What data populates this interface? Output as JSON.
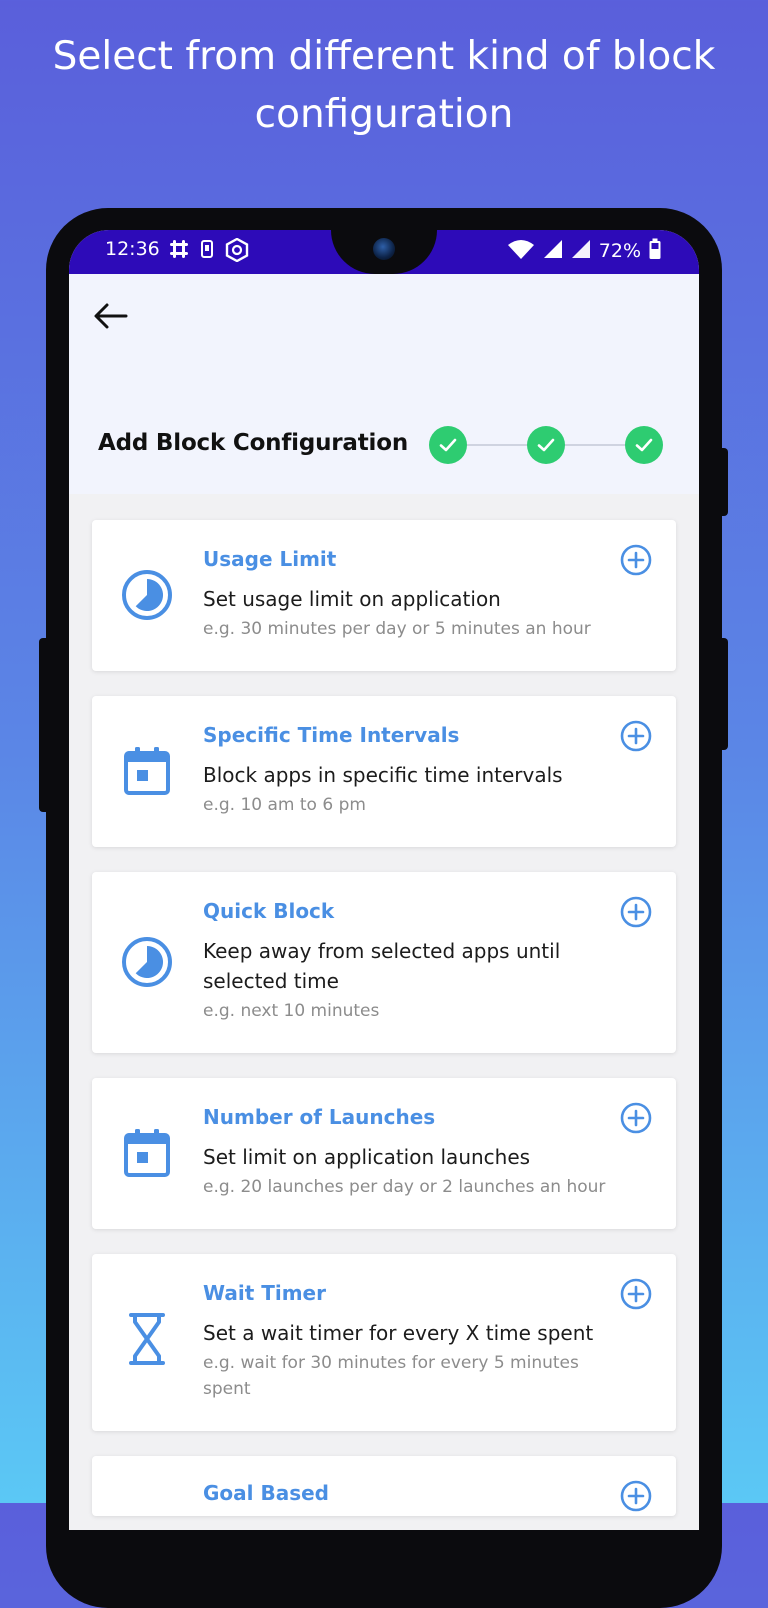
{
  "headline": {
    "line1": "Select from different kind of block",
    "line2": "configuration"
  },
  "status_bar": {
    "time": "12:36",
    "battery": "72%",
    "left_icons": [
      "slack-icon",
      "phone-outline-icon",
      "hexagon-app-icon"
    ],
    "right_icons": [
      "wifi-icon",
      "signal-icon",
      "signal-icon",
      "battery-icon"
    ]
  },
  "header": {
    "back_icon": "back-arrow-icon",
    "title": "Add Block Configuration",
    "steps_completed": 3,
    "steps_total": 3
  },
  "colors": {
    "status_bar": "#2d0bb8",
    "accent": "#4a8fe3",
    "step_done": "#2ecc71"
  },
  "cards": [
    {
      "icon": "clock-pie-icon",
      "title": "Usage Limit",
      "description": "Set usage limit on application",
      "example": "e.g. 30 minutes per day or 5 minutes an hour"
    },
    {
      "icon": "calendar-icon",
      "title": "Specific Time Intervals",
      "description": "Block apps in specific time intervals",
      "example": "e.g. 10 am to 6 pm"
    },
    {
      "icon": "clock-pie-icon",
      "title": "Quick Block",
      "description": "Keep away from selected apps until selected time",
      "example": "e.g. next 10 minutes"
    },
    {
      "icon": "calendar-icon",
      "title": "Number of Launches",
      "description": "Set limit on application launches",
      "example": "e.g. 20 launches per day or 2 launches an hour"
    },
    {
      "icon": "hourglass-icon",
      "title": "Wait Timer",
      "description": "Set a wait timer for every X time spent",
      "example": "e.g. wait for 30 minutes for every 5 minutes spent"
    },
    {
      "icon": "goal-icon",
      "title": "Goal Based",
      "description": "",
      "example": ""
    }
  ]
}
